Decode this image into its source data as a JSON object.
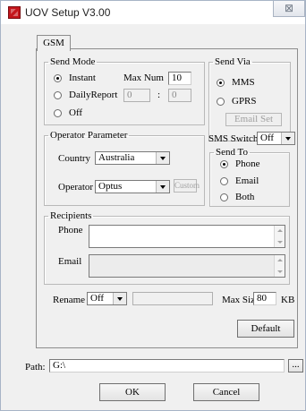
{
  "window": {
    "title": "UOV Setup V3.00",
    "close_glyph": "⊠"
  },
  "tabs": [
    {
      "label": "GSM"
    }
  ],
  "send_mode": {
    "legend": "Send Mode",
    "instant_label": "Instant",
    "max_num_label": "Max Num",
    "max_num_value": "10",
    "daily_label": "DailyReport",
    "daily_hour": "0",
    "daily_sep": ":",
    "daily_min": "0",
    "off_label": "Off",
    "selected": "Instant"
  },
  "send_via": {
    "legend": "Send Via",
    "mms_label": "MMS",
    "gprs_label": "GPRS",
    "email_set_label": "Email Set",
    "selected": "MMS"
  },
  "operator": {
    "legend": "Operator Parameter",
    "country_label": "Country",
    "country_value": "Australia",
    "operator_label": "Operator",
    "operator_value": "Optus",
    "custom_label": "Custom"
  },
  "sms": {
    "switch_label": "SMS Switch",
    "switch_value": "Off",
    "send_to_legend": "Send To",
    "phone_label": "Phone",
    "email_label": "Email",
    "both_label": "Both",
    "selected": "Phone"
  },
  "recipients": {
    "legend": "Recipients",
    "phone_label": "Phone",
    "email_label": "Email"
  },
  "rename": {
    "label": "Rename",
    "value": "Off",
    "max_size_label": "Max Size",
    "max_size_value": "80",
    "unit": "KB"
  },
  "default_label": "Default",
  "path": {
    "label": "Path:",
    "value": "G:\\",
    "browse_label": "..."
  },
  "ok_label": "OK",
  "cancel_label": "Cancel",
  "colors": {
    "accent_icon": "#c4161c",
    "background": "#f0f0f0"
  }
}
